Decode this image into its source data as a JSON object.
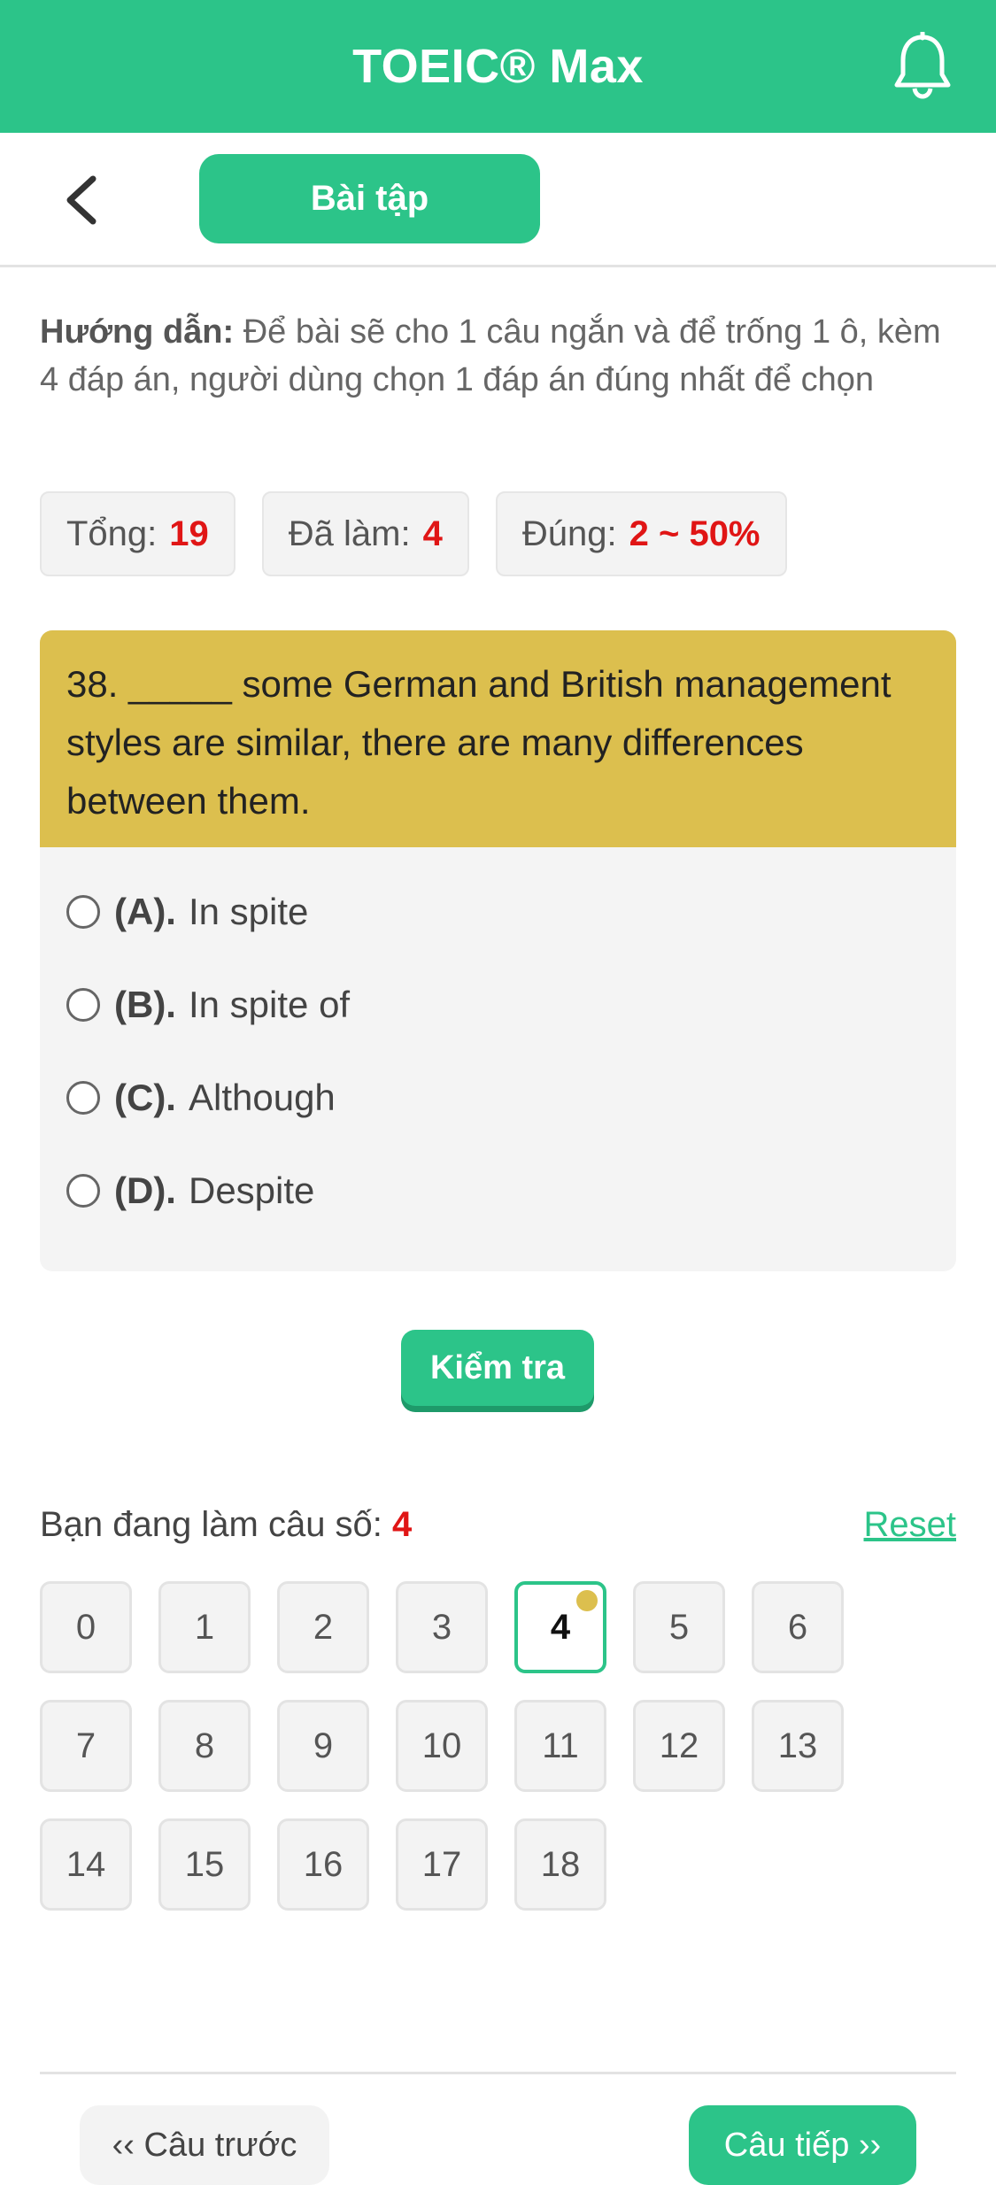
{
  "header": {
    "title": "TOEIC® Max",
    "bell_icon": "bell-icon"
  },
  "toolbar": {
    "back_icon": "chevron-left-icon",
    "tab_label": "Bài tập"
  },
  "instructions": {
    "lead": "Hướng dẫn:",
    "text": " Để bài sẽ cho 1 câu ngắn và để trống 1 ô, kèm 4 đáp án, người dùng chọn 1 đáp án đúng nhất để chọn"
  },
  "stats": [
    {
      "label": "Tổng:",
      "value": "19"
    },
    {
      "label": "Đã làm:",
      "value": "4"
    },
    {
      "label": "Đúng:",
      "value": "2 ~ 50%"
    }
  ],
  "question": {
    "text": "38. _____ some German and British management styles are similar, there are many differences between them.",
    "options": [
      {
        "letter": "(A).",
        "text": "In spite"
      },
      {
        "letter": "(B).",
        "text": "In spite of"
      },
      {
        "letter": "(C).",
        "text": "Although"
      },
      {
        "letter": "(D).",
        "text": "Despite"
      }
    ]
  },
  "check_button": "Kiểm tra",
  "progress": {
    "label": "Bạn đang làm câu số:",
    "current": "4",
    "reset": "Reset"
  },
  "grid": [
    "0",
    "1",
    "2",
    "3",
    "4",
    "5",
    "6",
    "7",
    "8",
    "9",
    "10",
    "11",
    "12",
    "13",
    "14",
    "15",
    "16",
    "17",
    "18"
  ],
  "current_index": 4,
  "nav": {
    "prev": "‹‹ Câu trước",
    "next": "Câu tiếp ››"
  },
  "colors": {
    "accent": "#2cc489",
    "question_bg": "#dcbf4e",
    "value_red": "#e01515"
  }
}
